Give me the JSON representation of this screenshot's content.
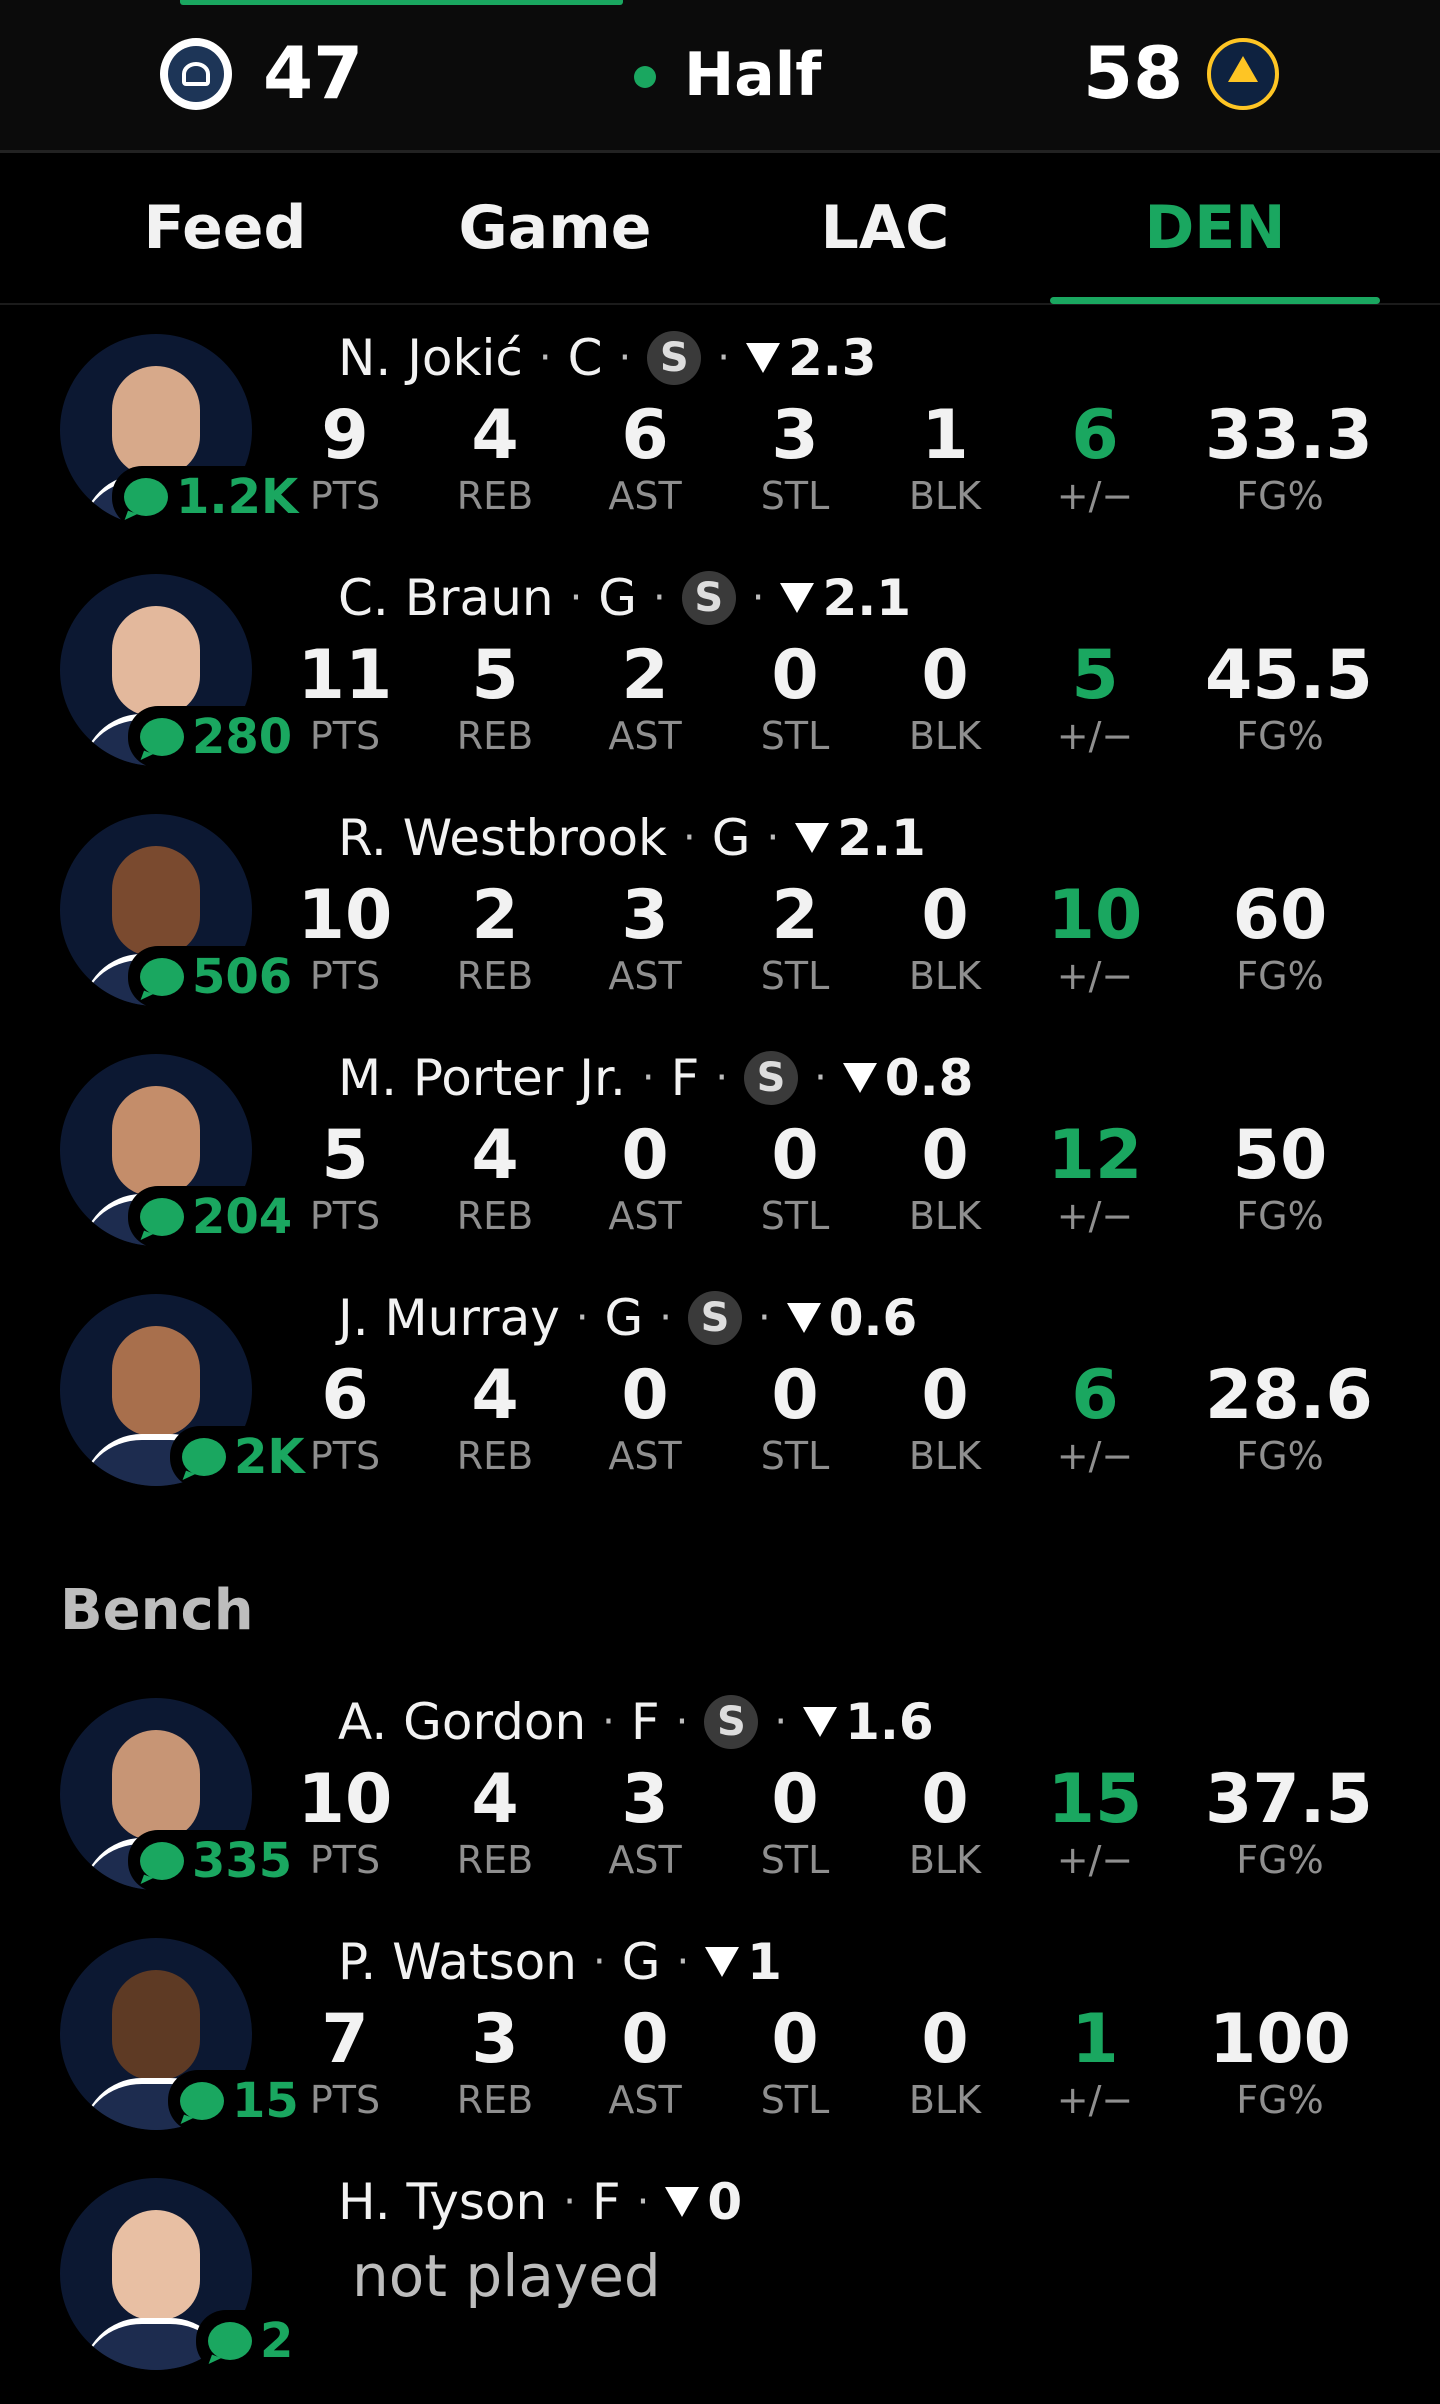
{
  "scoreboard": {
    "away_team_icon": "lac-logo-icon",
    "away_score": "47",
    "period": "Half",
    "home_score": "58",
    "home_team_icon": "den-logo-icon"
  },
  "tabs": [
    {
      "label": "Feed",
      "active": false
    },
    {
      "label": "Game",
      "active": false
    },
    {
      "label": "LAC",
      "active": false
    },
    {
      "label": "DEN",
      "active": true
    }
  ],
  "stat_labels": [
    "PTS",
    "REB",
    "AST",
    "STL",
    "BLK",
    "+/−",
    "FG%"
  ],
  "sep": "·",
  "starter_badge": "S",
  "starters": [
    {
      "name": "N. Jokić",
      "pos": "C",
      "starter": true,
      "rating": "2.3",
      "comments": "1.2K",
      "stats": [
        "9",
        "4",
        "6",
        "3",
        "1",
        "6",
        "33.3"
      ],
      "skin": "#d7a98a"
    },
    {
      "name": "C. Braun",
      "pos": "G",
      "starter": true,
      "rating": "2.1",
      "comments": "280",
      "stats": [
        "11",
        "5",
        "2",
        "0",
        "0",
        "5",
        "45.5"
      ],
      "skin": "#e3b89c"
    },
    {
      "name": "R. Westbrook",
      "pos": "G",
      "starter": false,
      "rating": "2.1",
      "comments": "506",
      "stats": [
        "10",
        "2",
        "3",
        "2",
        "0",
        "10",
        "60"
      ],
      "skin": "#7a4a2f"
    },
    {
      "name": "M. Porter Jr.",
      "pos": "F",
      "starter": true,
      "rating": "0.8",
      "comments": "204",
      "stats": [
        "5",
        "4",
        "0",
        "0",
        "0",
        "12",
        "50"
      ],
      "skin": "#c48d6a"
    },
    {
      "name": "J. Murray",
      "pos": "G",
      "starter": true,
      "rating": "0.6",
      "comments": "2K",
      "stats": [
        "6",
        "4",
        "0",
        "0",
        "0",
        "6",
        "28.6"
      ],
      "skin": "#a86f4c"
    }
  ],
  "bench_label": "Bench",
  "bench": [
    {
      "name": "A. Gordon",
      "pos": "F",
      "starter": true,
      "rating": "1.6",
      "comments": "335",
      "stats": [
        "10",
        "4",
        "3",
        "0",
        "0",
        "15",
        "37.5"
      ],
      "skin": "#c79575"
    },
    {
      "name": "P. Watson",
      "pos": "G",
      "starter": false,
      "rating": "1",
      "comments": "15",
      "stats": [
        "7",
        "3",
        "0",
        "0",
        "0",
        "1",
        "100"
      ],
      "skin": "#5e3a24"
    },
    {
      "name": "H. Tyson",
      "pos": "F",
      "starter": false,
      "rating": "0",
      "comments": "2",
      "not_played": "not played",
      "skin": "#e8bfa3"
    }
  ],
  "colors": {
    "accent": "#1aa760",
    "background": "#000000",
    "muted": "#8f8f8f"
  }
}
